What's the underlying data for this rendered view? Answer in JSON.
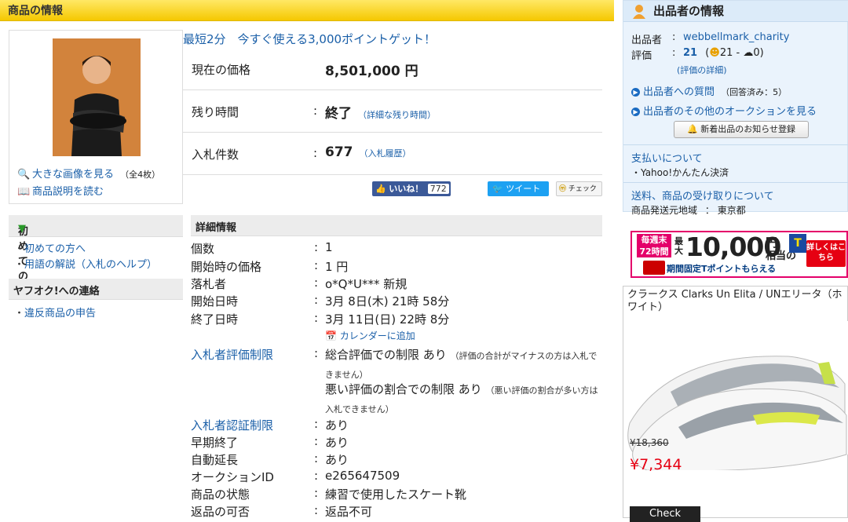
{
  "main": {
    "header": "商品の情報",
    "photo_links": {
      "large_image": "大きな画像を見る",
      "large_image_count": "（全4枚）",
      "description": "商品説明を読む"
    },
    "promo": "最短2分　今すぐ使える3,000ポイントゲット！",
    "price": {
      "label": "現在の価格",
      "value": "8,501,000 円"
    },
    "time_left": {
      "label": "残り時間",
      "value": "終了",
      "detail": "（詳細な残り時間）"
    },
    "bids": {
      "label": "入札件数",
      "value": "677",
      "history": "（入札履歴）"
    },
    "social": {
      "like": "いいね！",
      "like_count": "772",
      "tweet": "ツイート",
      "check": "チェック"
    }
  },
  "side": {
    "beginners_title": "初めての方",
    "beginners_items": [
      "初めての方へ",
      "用語の解説（入札のヘルプ）"
    ],
    "contact_title": "ヤフオク!への連絡",
    "contact_items": [
      "違反商品の申告"
    ]
  },
  "details": {
    "title": "詳細情報",
    "rows": {
      "quantity": {
        "label": "個数",
        "value": "1"
      },
      "start_price": {
        "label": "開始時の価格",
        "value": "1 円"
      },
      "winner": {
        "label": "落札者",
        "value": "o*Q*U*** 新規"
      },
      "start_date": {
        "label": "開始日時",
        "value": "3月 8日(木) 21時 58分"
      },
      "end_date": {
        "label": "終了日時",
        "value": "3月 11日(日) 22時 8分"
      },
      "calendar": "カレンダーに追加",
      "rating_limit": {
        "label": "入札者評価制限",
        "value1": "総合評価での制限 あり",
        "note1": "（評価の合計がマイナスの方は入札できません）",
        "value2": "悪い評価の割合での制限 あり",
        "note2": "（悪い評価の割合が多い方は入札できません）"
      },
      "auth_limit": {
        "label": "入札者認証制限",
        "value": "あり"
      },
      "early_end": {
        "label": "早期終了",
        "value": "あり"
      },
      "auto_extend": {
        "label": "自動延長",
        "value": "あり"
      },
      "auction_id": {
        "label": "オークションID",
        "value": "e265647509"
      },
      "condition": {
        "label": "商品の状態",
        "value": "練習で使用したスケート靴"
      },
      "returns": {
        "label": "返品の可否",
        "value": "返品不可"
      }
    }
  },
  "seller": {
    "header": "出品者の情報",
    "name_label": "出品者",
    "name": "webbellmark_charity",
    "rating_label": "評価",
    "rating": "21",
    "rating_good": "21",
    "rating_bad": "0",
    "rating_detail": "(評価の詳細)",
    "question": "出品者への質問",
    "question_note": "（回答済み：5）",
    "other_auctions": "出品者のその他のオークションを見る",
    "notify_button": "新着出品のお知らせ登録",
    "payment_title": "支払いについて",
    "payment_item": "Yahoo!かんたん決済",
    "shipping_title": "送料、商品の受け取りについて",
    "shipping_label": "商品発送元地域",
    "shipping_value": "東京都"
  },
  "banner": {
    "tag1": "毎週末",
    "tag2": "72時間",
    "max": "最大",
    "amount": "10,000",
    "unit": "円",
    "equiv": "相当の",
    "bottom": "期間固定Tポイントもらえる",
    "button": "詳しくはこちら"
  },
  "ad": {
    "title": "クラークス Clarks Un Elita / UNエリータ（ホワイト）",
    "old_price": "¥18,360",
    "price": "¥7,344",
    "button": "Check"
  },
  "colors": {
    "accent_yellow": "#f5c800",
    "link_blue": "#1a5fa8",
    "sale_red": "#e60012"
  }
}
